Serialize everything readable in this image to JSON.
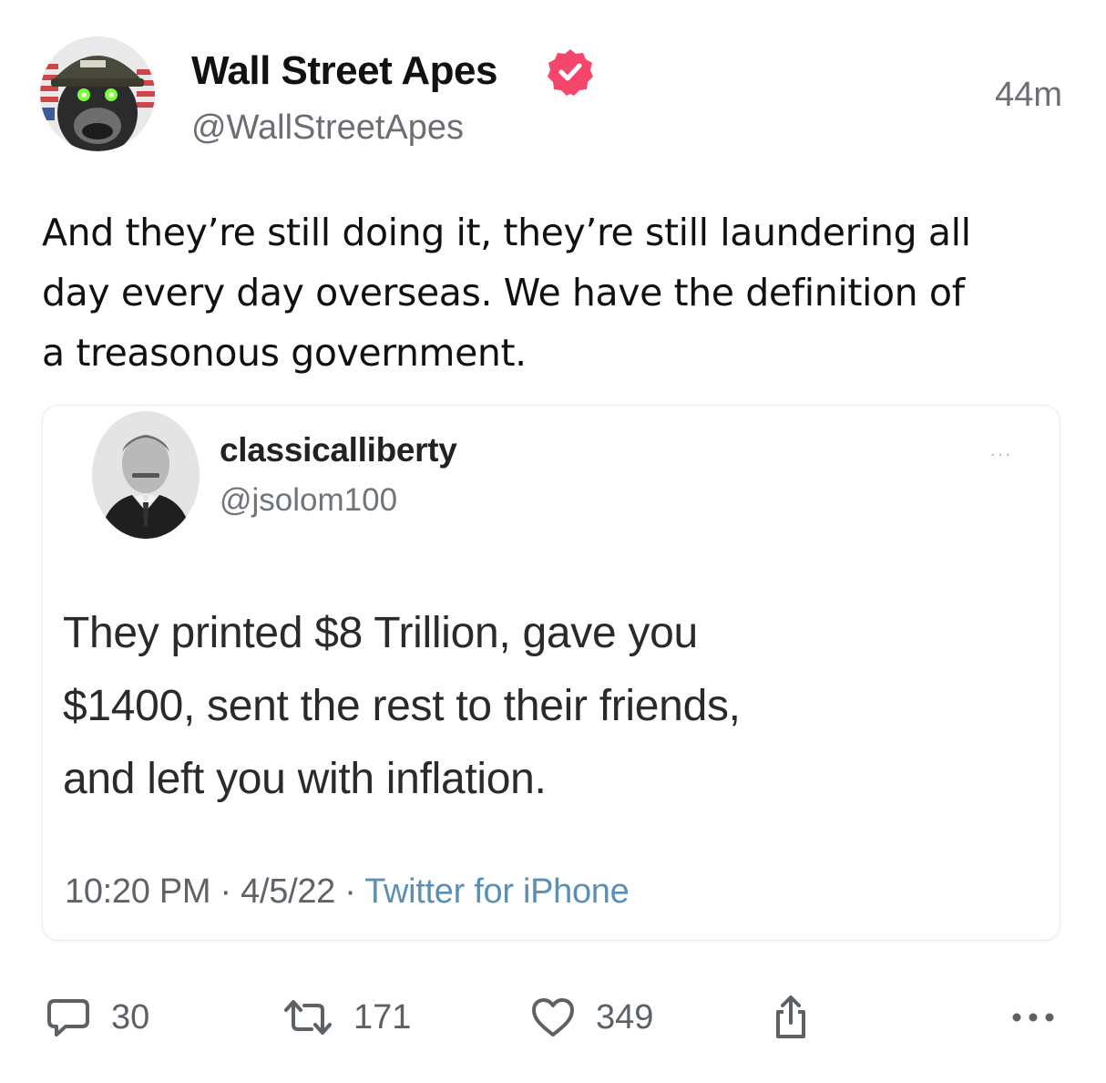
{
  "post": {
    "author": {
      "display_name": "Wall Street Apes",
      "handle": "@WallStreetApes",
      "verified": true,
      "avatar_icon": "gorilla-helmet-avatar"
    },
    "timestamp": "44m",
    "text_lines": [
      "And they’re still doing it, they’re still laundering all",
      "day every day overseas. We have the definition of",
      "a treasonous government."
    ],
    "embed": {
      "author": {
        "display_name": "classicalliberty",
        "handle": "@jsolom100",
        "avatar_icon": "portrait-avatar"
      },
      "more_label": "···",
      "text_lines": [
        "They printed $8 Trillion, gave you",
        "$1400, sent the rest to their friends,",
        "and left you with inflation."
      ],
      "time": "10:20 PM",
      "date": "4/5/22",
      "source": "Twitter for iPhone",
      "separator": " · "
    },
    "actions": {
      "replies": "30",
      "reposts": "171",
      "likes": "349"
    },
    "colors": {
      "verified_badge": "#f4476b",
      "meta_link": "#5b8fb3",
      "muted_text": "#6b6f74"
    }
  }
}
